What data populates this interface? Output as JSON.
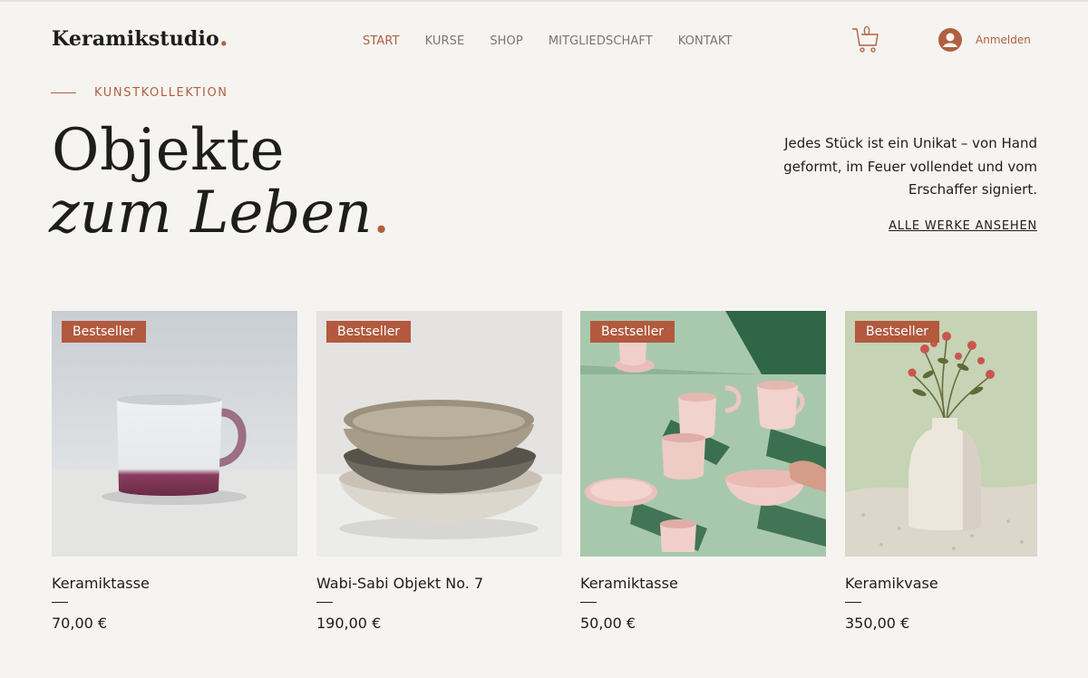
{
  "header": {
    "brand": "Keramikstudio",
    "brand_dot": ".",
    "nav": [
      {
        "label": "START",
        "active": true
      },
      {
        "label": "KURSE",
        "active": false
      },
      {
        "label": "SHOP",
        "active": false
      },
      {
        "label": "MITGLIEDSCHAFT",
        "active": false
      },
      {
        "label": "KONTAKT",
        "active": false
      }
    ],
    "cart_count": "0",
    "login_label": "Anmelden"
  },
  "hero": {
    "eyebrow": "KUNSTKOLLEKTION",
    "title_line1": "Objekte",
    "title_line2": "zum Leben",
    "title_dot": ".",
    "intro": "Jedes Stück ist ein Unikat – von Hand geformt, im Feuer vollendet und vom Erschaffer signiert.",
    "view_all": "ALLE WERKE ANSEHEN"
  },
  "products": [
    {
      "badge": "Bestseller",
      "name": "Keramiktasse",
      "price": "70,00 €"
    },
    {
      "badge": "Bestseller",
      "name": "Wabi-Sabi Objekt No. 7",
      "price": "190,00 €"
    },
    {
      "badge": "Bestseller",
      "name": "Keramiktasse",
      "price": "50,00 €"
    },
    {
      "badge": "Bestseller",
      "name": "Keramikvase",
      "price": "350,00 €"
    }
  ],
  "colors": {
    "accent": "#b06040",
    "badge_bg": "#b2593e",
    "background": "#f6f4f1",
    "text": "#1d1d1b"
  },
  "icons": {
    "cart": "shopping-cart-icon",
    "login": "user-avatar-icon"
  }
}
